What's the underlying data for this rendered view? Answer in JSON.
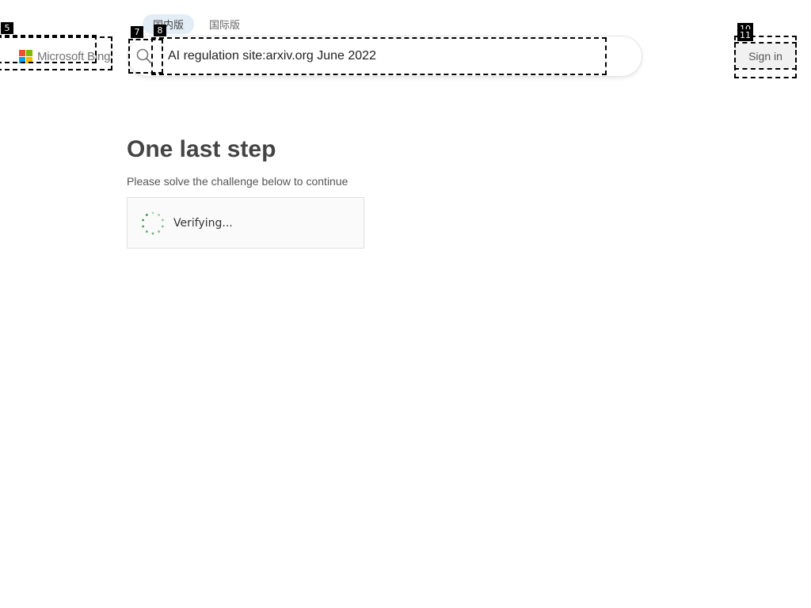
{
  "header": {
    "logo_text": "Microsoft Bing",
    "tabs": [
      {
        "label": "国内版",
        "active": true
      },
      {
        "label": "国际版",
        "active": false
      }
    ],
    "search": {
      "value": "AI regulation site:arxiv.org June 2022"
    },
    "signin_label": "Sign in"
  },
  "main": {
    "title": "One last step",
    "subtitle": "Please solve the challenge below to continue",
    "status": "Verifying..."
  },
  "marks": [
    "5",
    "7",
    "8",
    "10",
    "11"
  ],
  "colors": {
    "ms_red": "#f25022",
    "ms_green": "#7fba00",
    "ms_blue": "#00a4ef",
    "ms_yellow": "#ffb900",
    "spinner": "#1e8a3c"
  }
}
